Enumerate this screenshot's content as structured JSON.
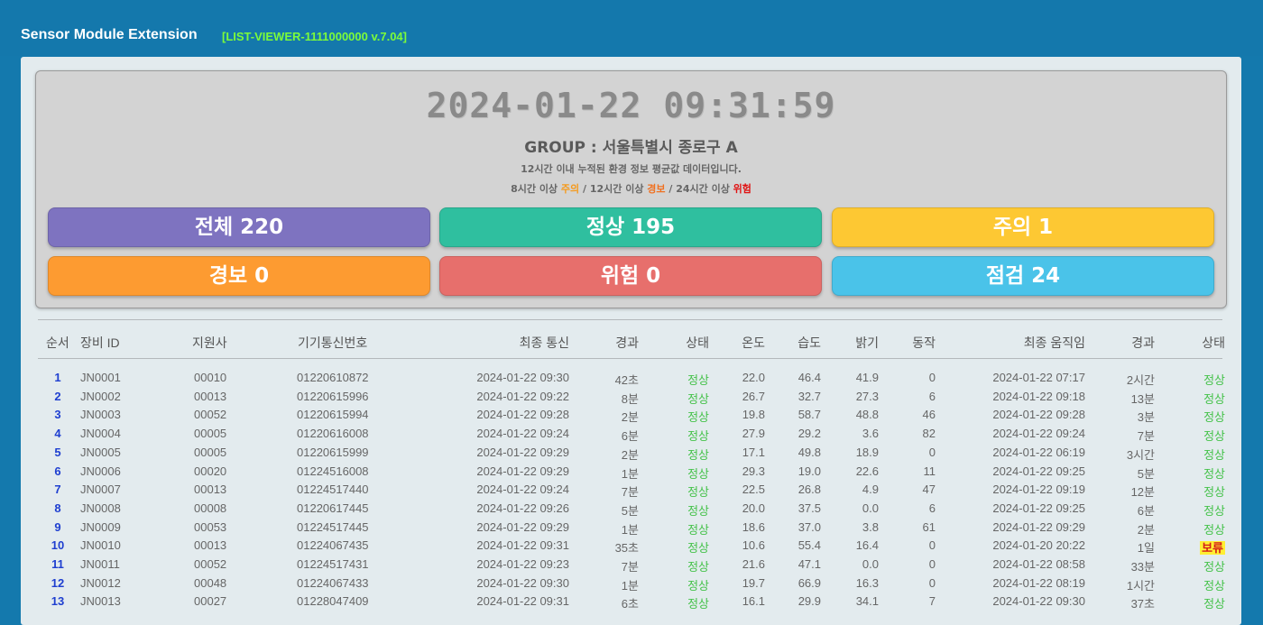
{
  "header": {
    "title": "Sensor Module Extension",
    "version": "[LIST-VIEWER-1111000000 v.7.04]"
  },
  "summary": {
    "clock": "2024-01-22 09:31:59",
    "group": "GROUP : 서울특별시 종로구 A",
    "info": "12시간 이내 누적된 환경 정보 평균값 데이터입니다.",
    "legend": {
      "p1": "8시간 이상 ",
      "caution": "주의",
      "p2": " / 12시간 이상 ",
      "warn": "경보",
      "p3": " / 24시간 이상 ",
      "danger": "위험"
    },
    "stats": {
      "total_label": "전체",
      "total": "220",
      "normal_label": "정상",
      "normal": "195",
      "caution_label": "주의",
      "caution": "1",
      "warn_label": "경보",
      "warn": "0",
      "danger_label": "위험",
      "danger": "0",
      "check_label": "점검",
      "check": "24"
    }
  },
  "table": {
    "headers": {
      "seq": "순서",
      "id": "장비 ID",
      "branch": "지원사",
      "phone": "기기통신번호",
      "last_comm": "최종 통신",
      "elapsed": "경과",
      "status": "상태",
      "temp": "온도",
      "humid": "습도",
      "bright": "밝기",
      "motion": "동작",
      "last_move": "최종 움직임",
      "elapsed2": "경과",
      "status2": "상태"
    },
    "rows": [
      {
        "seq": "1",
        "id": "JN0001",
        "branch": "00010",
        "phone": "01220610872",
        "last_comm": "2024-01-22 09:30",
        "elapsed": "42초",
        "status": "정상",
        "temp": "22.0",
        "humid": "46.4",
        "bright": "41.9",
        "motion": "0",
        "last_move": "2024-01-22 07:17",
        "elapsed2": "2시간",
        "status2": "정상"
      },
      {
        "seq": "2",
        "id": "JN0002",
        "branch": "00013",
        "phone": "01220615996",
        "last_comm": "2024-01-22 09:22",
        "elapsed": "8분",
        "status": "정상",
        "temp": "26.7",
        "humid": "32.7",
        "bright": "27.3",
        "motion": "6",
        "last_move": "2024-01-22 09:18",
        "elapsed2": "13분",
        "status2": "정상"
      },
      {
        "seq": "3",
        "id": "JN0003",
        "branch": "00052",
        "phone": "01220615994",
        "last_comm": "2024-01-22 09:28",
        "elapsed": "2분",
        "status": "정상",
        "temp": "19.8",
        "humid": "58.7",
        "bright": "48.8",
        "motion": "46",
        "last_move": "2024-01-22 09:28",
        "elapsed2": "3분",
        "status2": "정상"
      },
      {
        "seq": "4",
        "id": "JN0004",
        "branch": "00005",
        "phone": "01220616008",
        "last_comm": "2024-01-22 09:24",
        "elapsed": "6분",
        "status": "정상",
        "temp": "27.9",
        "humid": "29.2",
        "bright": "3.6",
        "motion": "82",
        "last_move": "2024-01-22 09:24",
        "elapsed2": "7분",
        "status2": "정상"
      },
      {
        "seq": "5",
        "id": "JN0005",
        "branch": "00005",
        "phone": "01220615999",
        "last_comm": "2024-01-22 09:29",
        "elapsed": "2분",
        "status": "정상",
        "temp": "17.1",
        "humid": "49.8",
        "bright": "18.9",
        "motion": "0",
        "last_move": "2024-01-22 06:19",
        "elapsed2": "3시간",
        "status2": "정상"
      },
      {
        "seq": "6",
        "id": "JN0006",
        "branch": "00020",
        "phone": "01224516008",
        "last_comm": "2024-01-22 09:29",
        "elapsed": "1분",
        "status": "정상",
        "temp": "29.3",
        "humid": "19.0",
        "bright": "22.6",
        "motion": "11",
        "last_move": "2024-01-22 09:25",
        "elapsed2": "5분",
        "status2": "정상"
      },
      {
        "seq": "7",
        "id": "JN0007",
        "branch": "00013",
        "phone": "01224517440",
        "last_comm": "2024-01-22 09:24",
        "elapsed": "7분",
        "status": "정상",
        "temp": "22.5",
        "humid": "26.8",
        "bright": "4.9",
        "motion": "47",
        "last_move": "2024-01-22 09:19",
        "elapsed2": "12분",
        "status2": "정상"
      },
      {
        "seq": "8",
        "id": "JN0008",
        "branch": "00008",
        "phone": "01220617445",
        "last_comm": "2024-01-22 09:26",
        "elapsed": "5분",
        "status": "정상",
        "temp": "20.0",
        "humid": "37.5",
        "bright": "0.0",
        "motion": "6",
        "last_move": "2024-01-22 09:25",
        "elapsed2": "6분",
        "status2": "정상"
      },
      {
        "seq": "9",
        "id": "JN0009",
        "branch": "00053",
        "phone": "01224517445",
        "last_comm": "2024-01-22 09:29",
        "elapsed": "1분",
        "status": "정상",
        "temp": "18.6",
        "humid": "37.0",
        "bright": "3.8",
        "motion": "61",
        "last_move": "2024-01-22 09:29",
        "elapsed2": "2분",
        "status2": "정상"
      },
      {
        "seq": "10",
        "id": "JN0010",
        "branch": "00013",
        "phone": "01224067435",
        "last_comm": "2024-01-22 09:31",
        "elapsed": "35초",
        "status": "정상",
        "temp": "10.6",
        "humid": "55.4",
        "bright": "16.4",
        "motion": "0",
        "last_move": "2024-01-20 20:22",
        "elapsed2": "1일",
        "status2": "보류",
        "hold": true
      },
      {
        "seq": "11",
        "id": "JN0011",
        "branch": "00052",
        "phone": "01224517431",
        "last_comm": "2024-01-22 09:23",
        "elapsed": "7분",
        "status": "정상",
        "temp": "21.6",
        "humid": "47.1",
        "bright": "0.0",
        "motion": "0",
        "last_move": "2024-01-22 08:58",
        "elapsed2": "33분",
        "status2": "정상"
      },
      {
        "seq": "12",
        "id": "JN0012",
        "branch": "00048",
        "phone": "01224067433",
        "last_comm": "2024-01-22 09:30",
        "elapsed": "1분",
        "status": "정상",
        "temp": "19.7",
        "humid": "66.9",
        "bright": "16.3",
        "motion": "0",
        "last_move": "2024-01-22 08:19",
        "elapsed2": "1시간",
        "status2": "정상"
      },
      {
        "seq": "13",
        "id": "JN0013",
        "branch": "00027",
        "phone": "01228047409",
        "last_comm": "2024-01-22 09:31",
        "elapsed": "6초",
        "status": "정상",
        "temp": "16.1",
        "humid": "29.9",
        "bright": "34.1",
        "motion": "7",
        "last_move": "2024-01-22 09:30",
        "elapsed2": "37초",
        "status2": "정상"
      }
    ]
  }
}
